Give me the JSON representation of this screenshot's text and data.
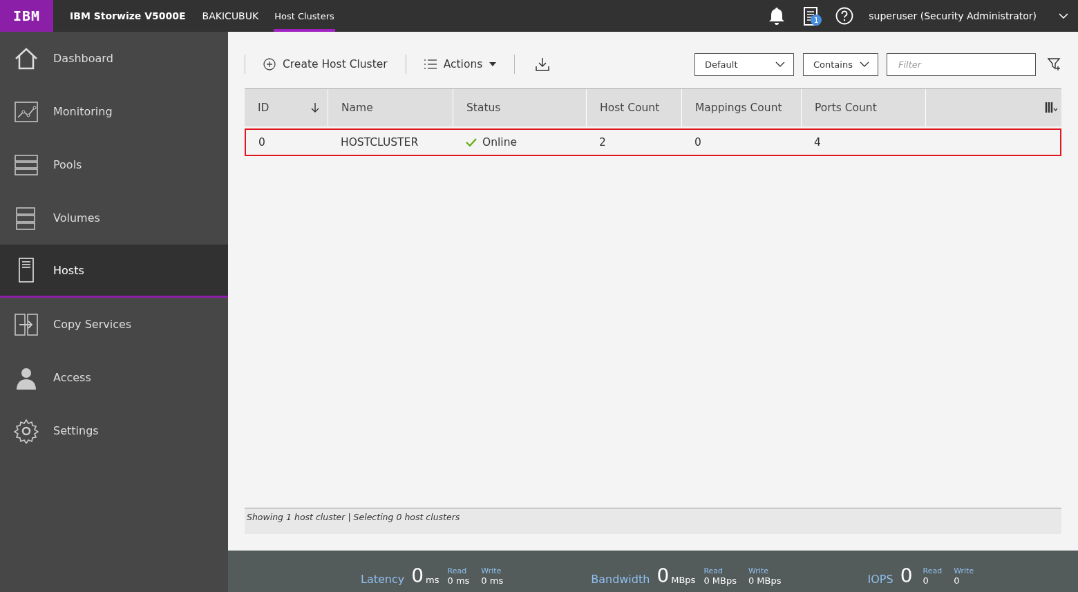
{
  "header": {
    "logo": "IBM",
    "product": "IBM Storwize V5000E",
    "system": "BAKICUBUK",
    "breadcrumb": "Host Clusters",
    "tasks_badge": "1",
    "user": "superuser (Security Administrator)"
  },
  "sidebar": {
    "items": [
      {
        "label": "Dashboard",
        "selected": false
      },
      {
        "label": "Monitoring",
        "selected": false
      },
      {
        "label": "Pools",
        "selected": false
      },
      {
        "label": "Volumes",
        "selected": false
      },
      {
        "label": "Hosts",
        "selected": true
      },
      {
        "label": "Copy Services",
        "selected": false
      },
      {
        "label": "Access",
        "selected": false
      },
      {
        "label": "Settings",
        "selected": false
      }
    ]
  },
  "toolbar": {
    "create": "Create Host Cluster",
    "actions": "Actions",
    "filter_scope": "Default",
    "filter_match": "Contains",
    "filter": {
      "placeholder": "Filter"
    }
  },
  "table": {
    "columns": [
      {
        "label": "ID",
        "sorted": true
      },
      {
        "label": "Name",
        "sorted": false
      },
      {
        "label": "Status",
        "sorted": false
      },
      {
        "label": "Host Count",
        "sorted": false
      },
      {
        "label": "Mappings Count",
        "sorted": false
      },
      {
        "label": "Ports Count",
        "sorted": false
      }
    ],
    "rows": [
      {
        "cells": [
          "0",
          "HOSTCLUSTER",
          "Online",
          "2",
          "0",
          "4"
        ],
        "kind": "online",
        "highlighted": true
      }
    ]
  },
  "status_bar": "Showing 1 host cluster | Selecting 0 host clusters",
  "performance": [
    {
      "label": "Latency",
      "value": "0",
      "unit": "ms",
      "read_label": "Read",
      "read": "0 ms",
      "write_label": "Write",
      "write": "0 ms"
    },
    {
      "label": "Bandwidth",
      "value": "0",
      "unit": "MBps",
      "read_label": "Read",
      "read": "0 MBps",
      "write_label": "Write",
      "write": "0 MBps"
    },
    {
      "label": "IOPS",
      "value": "0",
      "read_label": "Read",
      "read": "0",
      "write_label": "Write",
      "write": "0"
    }
  ]
}
